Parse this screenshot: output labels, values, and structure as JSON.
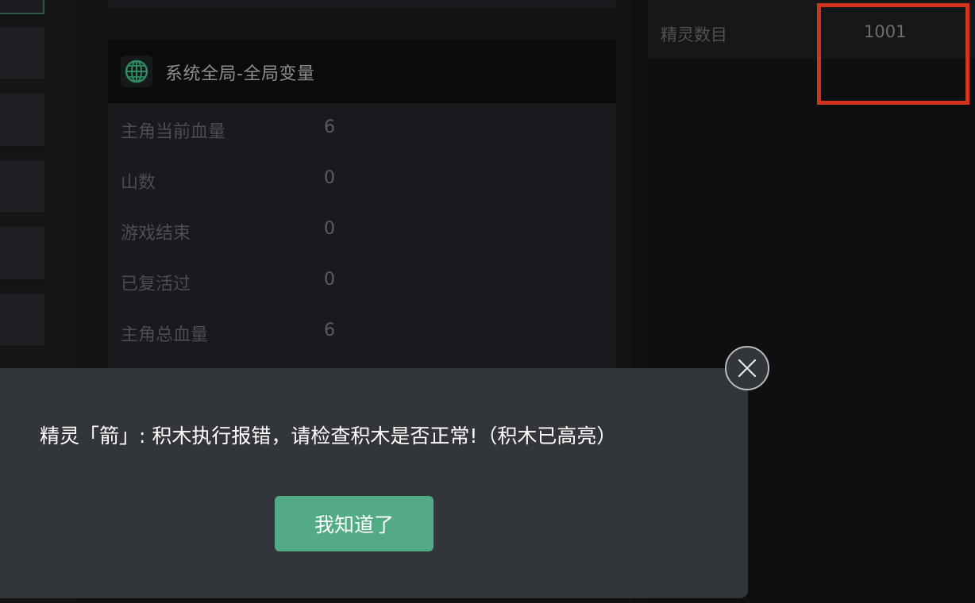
{
  "variables_panel": {
    "title": "系统全局-全局变量",
    "icon": "globe-icon",
    "rows": [
      {
        "name": "主角当前血量",
        "value": "6"
      },
      {
        "name": "山数",
        "value": "0"
      },
      {
        "name": "游戏结束",
        "value": "0"
      },
      {
        "name": "已复活过",
        "value": "0"
      },
      {
        "name": "主角总血量",
        "value": "6"
      }
    ]
  },
  "sprite_panel": {
    "label": "精灵数目",
    "value": "1001"
  },
  "dialog": {
    "message": "精灵「箭」: 积木执行报错，请检查积木是否正常!（积木已高亮）",
    "confirm_label": "我知道了",
    "close_icon": "close-icon"
  },
  "colors": {
    "accent": "#52ab86",
    "highlight": "#d0341f",
    "modal_bg": "#32353a"
  }
}
